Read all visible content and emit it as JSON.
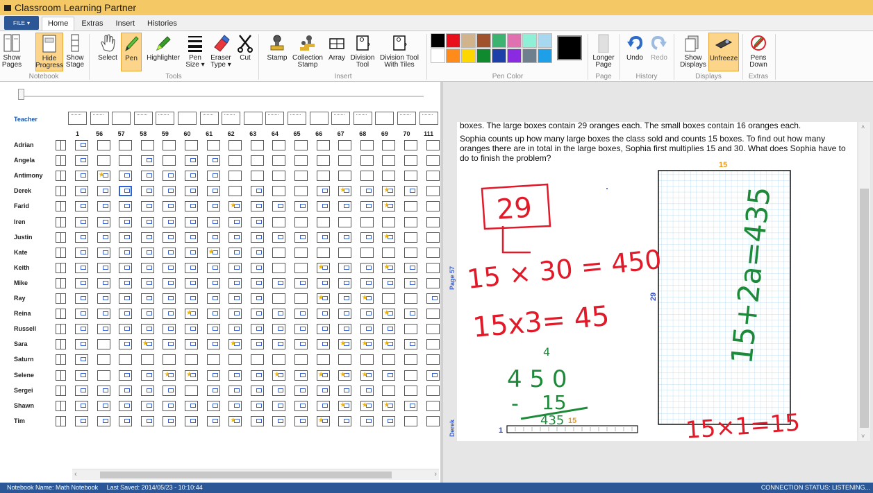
{
  "window": {
    "title": "Classroom Learning Partner"
  },
  "menu": {
    "file_label": "FILE",
    "tabs": [
      {
        "label": "Home",
        "active": true
      },
      {
        "label": "Extras",
        "active": false
      },
      {
        "label": "Insert",
        "active": false
      },
      {
        "label": "Histories",
        "active": false
      }
    ]
  },
  "ribbon": {
    "groups": {
      "notebook": "Notebook",
      "tools": "Tools",
      "insert": "Insert",
      "pen_color": "Pen Color",
      "page": "Page",
      "history": "History",
      "displays": "Displays",
      "extras": "Extras"
    },
    "buttons": {
      "show_pages": [
        "Show",
        "Pages"
      ],
      "hide_progress": [
        "Hide",
        "Progress"
      ],
      "show_stage": [
        "Show",
        "Stage"
      ],
      "select": [
        "Select"
      ],
      "pen": [
        "Pen"
      ],
      "highlighter": [
        "Highlighter"
      ],
      "pen_size": [
        "Pen",
        "Size ▾"
      ],
      "eraser_type": [
        "Eraser",
        "Type ▾"
      ],
      "cut": [
        "Cut"
      ],
      "stamp": [
        "Stamp"
      ],
      "collection_stamp": [
        "Collection",
        "Stamp"
      ],
      "array": [
        "Array"
      ],
      "division_tool": [
        "Division",
        "Tool"
      ],
      "division_tool_tiles": [
        "Division Tool",
        "With Tiles"
      ],
      "longer_page": [
        "Longer",
        "Page"
      ],
      "undo": [
        "Undo"
      ],
      "redo": [
        "Redo"
      ],
      "show_displays": [
        "Show",
        "Displays"
      ],
      "unfreeze": [
        "Unfreeze"
      ],
      "pens_down": [
        "Pens",
        "Down"
      ]
    },
    "colors_row1": [
      "#000000",
      "#e8101c",
      "#d2b48c",
      "#a0522d",
      "#3cb371",
      "#e070b0",
      "#8ff0d8",
      "#a7d8f0"
    ],
    "colors_row2": [
      "#ffffff",
      "#ff8c1a",
      "#ffd700",
      "#0f8a2e",
      "#1c3fa8",
      "#8a2be2",
      "#6e7f8e",
      "#1ea0e8"
    ],
    "current_color": "#000000"
  },
  "progress": {
    "teacher_label": "Teacher",
    "pages": [
      "1",
      "56",
      "57",
      "58",
      "59",
      "60",
      "61",
      "62",
      "63",
      "64",
      "65",
      "66",
      "67",
      "68",
      "69",
      "70",
      "111"
    ],
    "students": [
      {
        "name": "Adrian",
        "cells": "E.........................."
      },
      {
        "name": "Angela",
        "cells": "E..E.EE.........."
      },
      {
        "name": "Antimony",
        "cells": "ESEEEEE.........."
      },
      {
        "name": "Derek",
        "cells": "EEEEEEE.E..ESESE."
      },
      {
        "name": "Farid",
        "cells": "EEEEEEESEEEEEES.."
      },
      {
        "name": "Iren",
        "cells": "EEEEEEEEE........"
      },
      {
        "name": "Justin",
        "cells": "EEEEEEEEEEEEEES.."
      },
      {
        "name": "Kate",
        "cells": "EEEEEESEE........"
      },
      {
        "name": "Keith",
        "cells": "EEEEEEEEE..SEESE."
      },
      {
        "name": "Mike",
        "cells": "EEEEEEEEEEEEEEEE."
      },
      {
        "name": "Ray",
        "cells": "EEEEEEEEE..SES..E"
      },
      {
        "name": "Reina",
        "cells": "EEEEESEEEEEEEESE."
      },
      {
        "name": "Russell",
        "cells": "EEEEEEEEEEEEEEE.."
      },
      {
        "name": "Sara",
        "cells": "E.ESEEESEEEESSSE."
      },
      {
        "name": "Saturn",
        "cells": "E................"
      },
      {
        "name": "Selene",
        "cells": "E.EESSEEESESSSE.E"
      },
      {
        "name": "Sergei",
        "cells": "EEEEE.EEEEEEEE..."
      },
      {
        "name": "Shawn",
        "cells": "EEEEEEEEEEEESSSE."
      },
      {
        "name": "Tim",
        "cells": "EEEEEEESEEESEEE.."
      }
    ]
  },
  "page": {
    "text_line1": "boxes. The large boxes contain 29 oranges each. The small boxes contain 16 oranges each.",
    "text_para2": "Sophia counts up how many large boxes the class sold and counts 15 boxes. To find out how many oranges there are in total in the large boxes, Sophia first multiplies 15 and 30. What does Sophia have to do to finish the problem?",
    "page_label": "Page 57",
    "student_label": "Derek",
    "array_top_label": "15",
    "array_side_label": "29",
    "strip_left_label": "1",
    "strip_right_label": "15",
    "ink": {
      "boxed": "29",
      "eq1": "15 × 30 = 450",
      "eq2": "15x3= 45",
      "sub_top": "4 5 0",
      "sub_carry": "4",
      "sub_minus": "-",
      "sub_mid": "15",
      "sub_bottom": "435",
      "vertical": "15+2a=435",
      "bottom": "15×1=15"
    }
  },
  "status": {
    "notebook_name": "Notebook Name: Math Notebook",
    "last_saved": "Last Saved: 2014/05/23 - 10:10:44",
    "connection": "CONNECTION STATUS: LISTENING..."
  }
}
